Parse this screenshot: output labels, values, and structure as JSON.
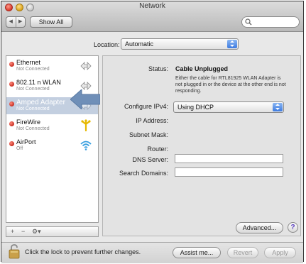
{
  "window": {
    "title": "Network"
  },
  "toolbar": {
    "back_label": "◀",
    "forward_label": "▶",
    "show_all_label": "Show All",
    "search_placeholder": ""
  },
  "location": {
    "label": "Location:",
    "value": "Automatic"
  },
  "services": [
    {
      "name": "Ethernet",
      "status": "Not Connected",
      "icon": "ethernet-arrows-icon"
    },
    {
      "name": "802.11 n WLAN",
      "status": "Not Connected",
      "icon": "ethernet-arrows-icon"
    },
    {
      "name": "Amped Adapter",
      "status": "Not Connected",
      "icon": "ethernet-arrows-icon",
      "selected": true
    },
    {
      "name": "FireWire",
      "status": "Not Connected",
      "icon": "firewire-icon"
    },
    {
      "name": "AirPort",
      "status": "Off",
      "icon": "wifi-icon"
    }
  ],
  "sidebar_footer": {
    "add": "+",
    "remove": "−",
    "action": "⚙▾"
  },
  "detail": {
    "status_label": "Status:",
    "status_value": "Cable Unplugged",
    "status_note": "Either the cable for RTL81925 WLAN Adapter is not plugged in or the device at the other end is not responding.",
    "configure_label": "Configure IPv4:",
    "configure_value": "Using DHCP",
    "ip_label": "IP Address:",
    "subnet_label": "Subnet Mask:",
    "router_label": "Router:",
    "dns_label": "DNS Server:",
    "search_domains_label": "Search Domains:",
    "advanced_label": "Advanced...",
    "help_label": "?"
  },
  "bottom": {
    "lock_text": "Click the lock to prevent further changes.",
    "assist_label": "Assist me...",
    "revert_label": "Revert",
    "apply_label": "Apply"
  },
  "colors": {
    "status_dot": "#c62b1f",
    "selection": "#c3cfe0",
    "popup_accent": "#3d7be0",
    "callout_arrow": "#6f8fb8"
  }
}
